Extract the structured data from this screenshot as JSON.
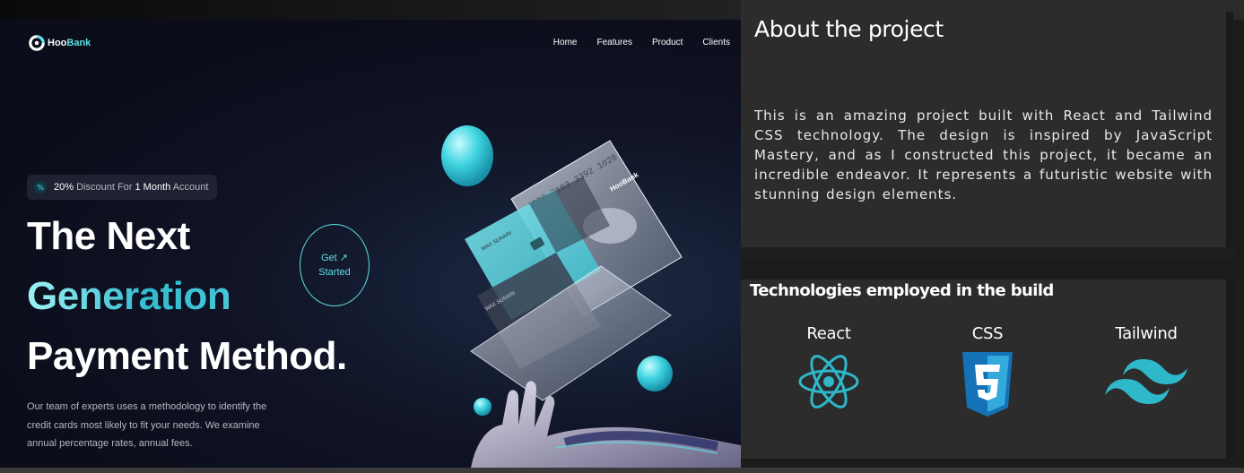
{
  "preview": {
    "logo": {
      "text_main": "Hoo",
      "text_accent": "Bank"
    },
    "nav": [
      "Home",
      "Features",
      "Product",
      "Clients"
    ],
    "badge": {
      "icon": "percent-icon",
      "pct": "20%",
      "mid": " Discount For ",
      "strong": "1 Month",
      "tail": " Account"
    },
    "headline": [
      "The Next",
      "Generation",
      "Payment Method."
    ],
    "description": "Our team of experts uses a methodology to identify the credit cards most likely to fit your needs. We examine annual percentage rates, annual fees.",
    "cta": {
      "line1": "Get ↗",
      "line2": "Started"
    },
    "card_number": "1833 7183 3392 1028",
    "card_holder": "WAX SUNARI",
    "card_logo": "HooBank"
  },
  "about": {
    "title": "About the project",
    "text": "This is an amazing project built with React and Tailwind CSS technology. The design is inspired by JavaScript Mastery, and as I constructed this project, it became an incredible endeavor. It represents a futuristic website with stunning design elements."
  },
  "tech": {
    "title": "Technologies employed in the build",
    "items": [
      {
        "label": "React",
        "icon": "react-icon"
      },
      {
        "label": "CSS",
        "icon": "css3-icon"
      },
      {
        "label": "Tailwind",
        "icon": "tailwind-icon"
      }
    ]
  },
  "colors": {
    "accent": "#5ce1e6",
    "bg_dark": "#0b0d1a",
    "panel": "#2c2c2c"
  }
}
